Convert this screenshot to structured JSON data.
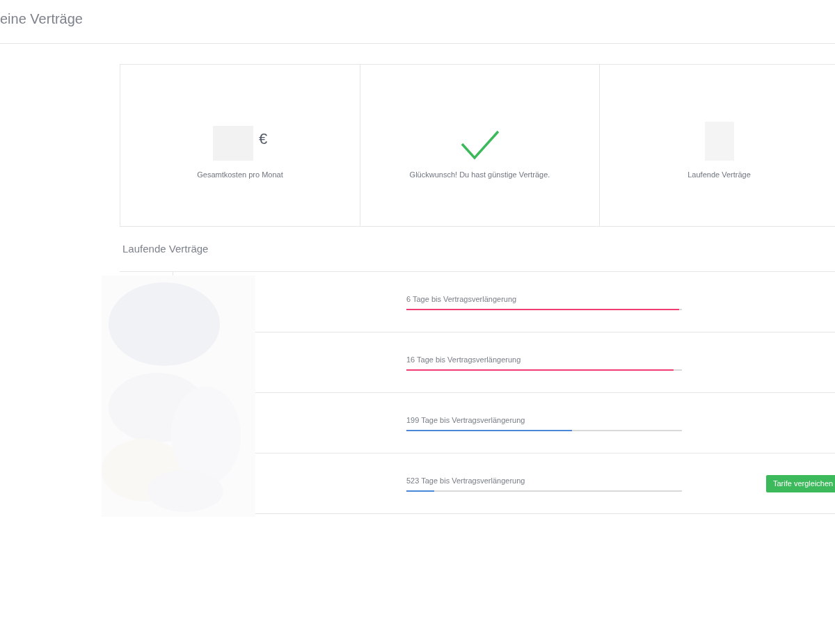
{
  "header": {
    "title": "eine Verträge"
  },
  "summary": [
    {
      "kind": "amount",
      "currency": "€",
      "label": "Gesamtkosten pro Monat"
    },
    {
      "kind": "check",
      "label": "Glückwunsch! Du hast günstige Verträge."
    },
    {
      "kind": "count",
      "label": "Laufende Verträge"
    }
  ],
  "contracts_section": {
    "title": "Laufende Verträge",
    "rows": [
      {
        "renewal": "6 Tage bis Vertragsverlängerung",
        "level": 0.99,
        "color": "#ef3d73"
      },
      {
        "renewal": "16 Tage bis Vertragsverlängerung",
        "level": 0.97,
        "color": "#ef3d73"
      },
      {
        "renewal": "199 Tage bis Vertragsverlängerung",
        "level": 0.6,
        "color": "#4a87d6"
      },
      {
        "renewal": "523 Tage bis Vertragsverlängerung",
        "level": 0.1,
        "color": "#4a87d6",
        "action": "Tarife vergleichen"
      }
    ]
  }
}
